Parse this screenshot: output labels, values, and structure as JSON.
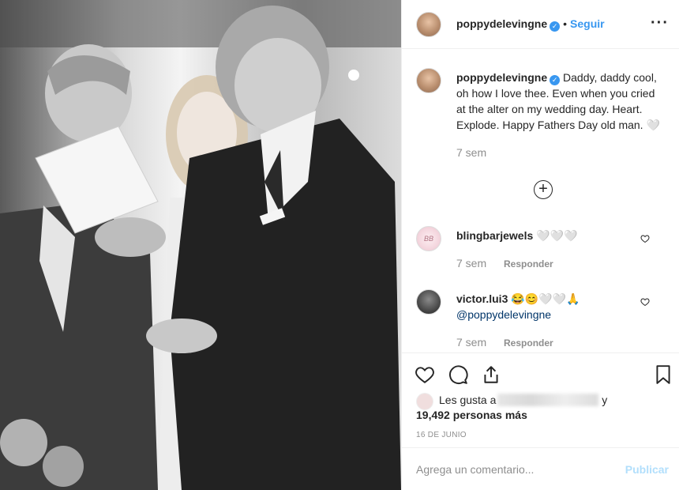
{
  "post": {
    "username": "poppydelevingne",
    "follow_label": "Seguir",
    "more_label": "···"
  },
  "caption": {
    "username": "poppydelevingne",
    "text": "Daddy, daddy cool, oh how I love thee. Even when you cried at the alter on my wedding day. Heart. Explode. Happy Fathers Day old man. 🤍",
    "time": "7 sem"
  },
  "comments": [
    {
      "username": "blingbarjewels",
      "text": "🤍🤍🤍",
      "time": "7 sem",
      "reply_label": "Responder",
      "avatar_text": "BB"
    },
    {
      "username": "victor.lui3",
      "text": "😂😊🤍🤍🙏",
      "mention": "@poppydelevingne",
      "time": "7 sem",
      "reply_label": "Responder"
    }
  ],
  "likes": {
    "prefix": "Les gusta a",
    "suffix": "y",
    "count_text": "19,492 personas más"
  },
  "date": "16 DE JUNIO",
  "add_comment": {
    "placeholder": "Agrega un comentario...",
    "publish_label": "Publicar"
  },
  "colors": {
    "accent": "#3897f0",
    "publish_disabled": "#b2dffc",
    "muted": "#8e8e8e"
  },
  "icons": [
    "heart-icon",
    "comment-icon",
    "share-icon",
    "bookmark-icon",
    "plus-circle-icon",
    "more-icon",
    "verified-icon"
  ]
}
